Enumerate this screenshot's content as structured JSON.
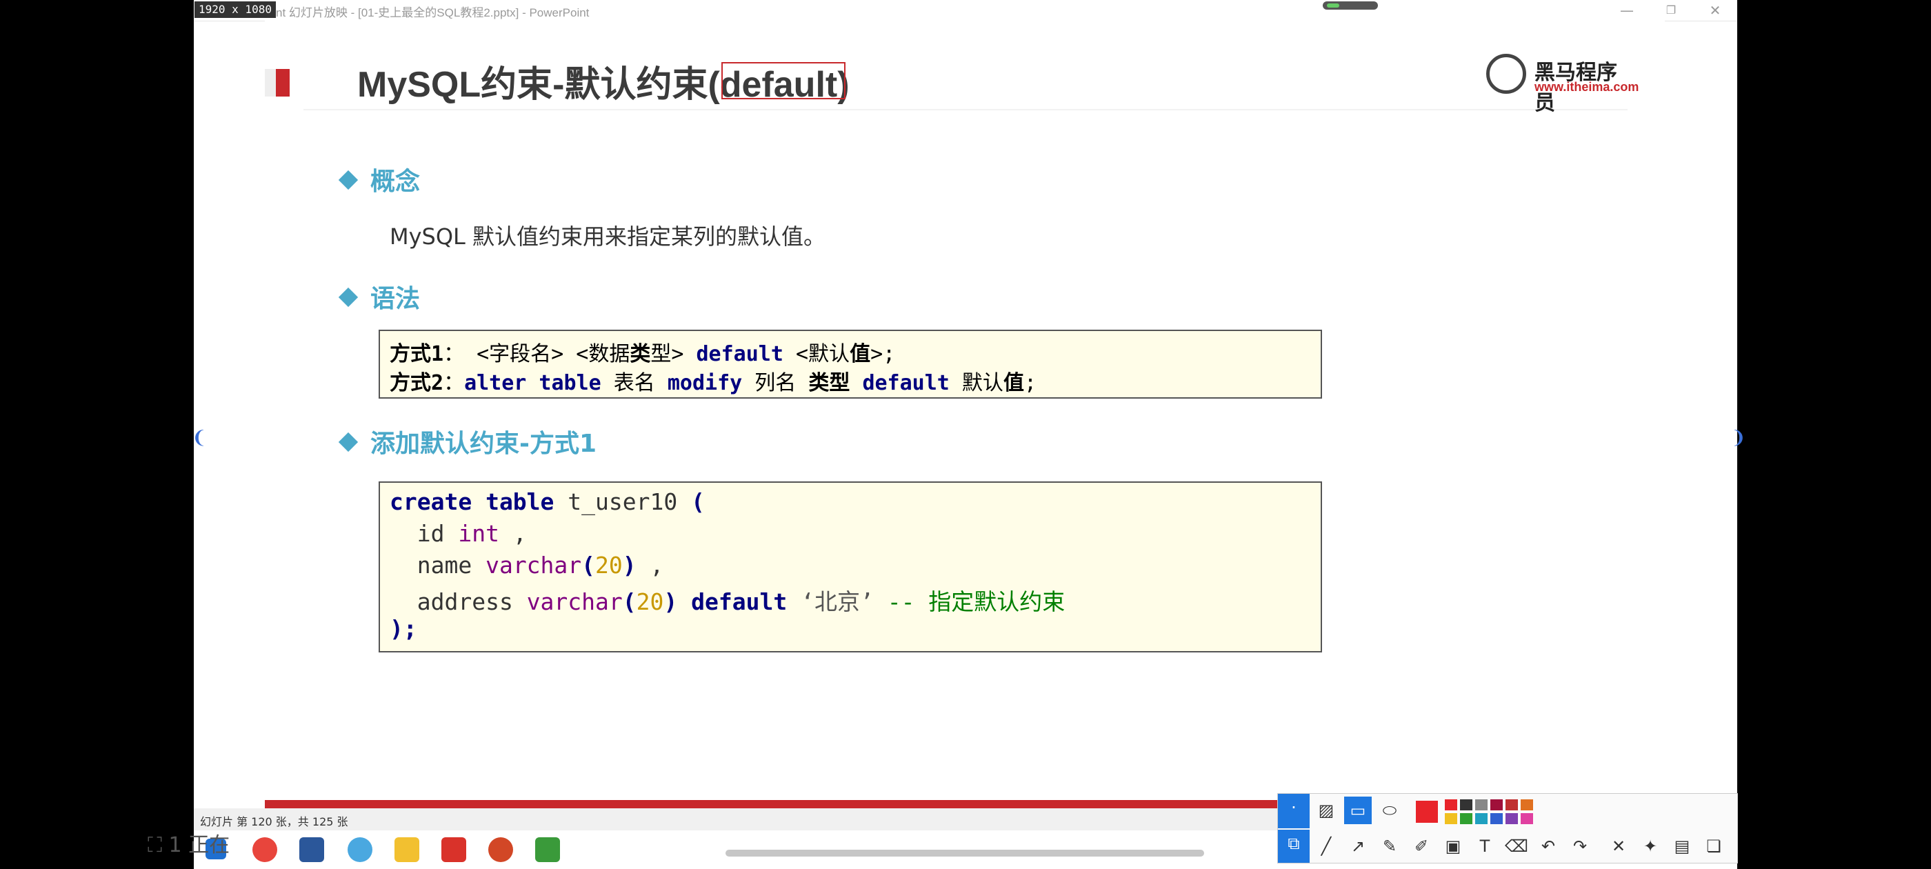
{
  "window": {
    "resolution_badge": "1920 x 1080",
    "title": "nt 幻灯片放映 - [01-史上最全的SQL教程2.pptx] - PowerPoint",
    "minimize": "—",
    "restore": "❐",
    "close": "✕"
  },
  "slide": {
    "title": "MySQL约束-默认约束(default)",
    "logo_name": "黑马程序员",
    "logo_url": "www.itheima.com",
    "sections": {
      "concept": {
        "heading": "概念",
        "text": "MySQL 默认值约束用来指定某列的默认值。"
      },
      "syntax": {
        "heading": "语法",
        "line1": {
          "prefix": "方式1",
          "colon": "：",
          "t1": " <字段名> <数据",
          "t2": "类",
          "t3": "型> ",
          "kw": "default",
          "t4": " <默认",
          "t5": "值",
          "t6": ">;"
        },
        "line2": {
          "prefix": "方式2",
          "colon": "：",
          "kw1": "alter table",
          "t1": " 表名 ",
          "kw2": "modify",
          "t2": " 列名 ",
          "t3": "类型",
          "sp": " ",
          "kw3": "default",
          "t4": " 默认",
          "t5": "值",
          "t6": ";"
        }
      },
      "add_default": {
        "heading": "添加默认约束-方式1",
        "code": {
          "l1_kw": "create table",
          "l1_rest": " t_user10 ",
          "l1_paren": "(",
          "l2_a": "  id ",
          "l2_type": "int",
          "l2_b": " ,",
          "l3_a": "  name ",
          "l3_type": "varchar",
          "l3_p1": "(",
          "l3_num": "20",
          "l3_p2": ")",
          "l3_b": " ,",
          "l4_a": "  address ",
          "l4_type": "varchar",
          "l4_p1": "(",
          "l4_num": "20",
          "l4_p2": ")",
          "l4_sp": " ",
          "l4_kw": "default",
          "l4_str": " ‘北京’ ",
          "l4_cmt": "-- 指定默认约束",
          "l5": ");"
        }
      }
    }
  },
  "statusbar": {
    "text": "幻灯片 第 120 张，共 125 张"
  },
  "watermark": "⛶ 1 正在",
  "colors": {
    "accent_red": "#c8282c",
    "heading_blue": "#4aa8c9",
    "keyword_navy": "#00007f",
    "code_bg": "#fffde8"
  },
  "annotation_toolbar": {
    "colors": [
      "#e8242a",
      "#333333",
      "#888888",
      "#a0103a",
      "#c03030",
      "#e07020",
      "#f0c020",
      "#30a030",
      "#20a0c0",
      "#3060d0",
      "#8040b0",
      "#e040a0"
    ]
  }
}
